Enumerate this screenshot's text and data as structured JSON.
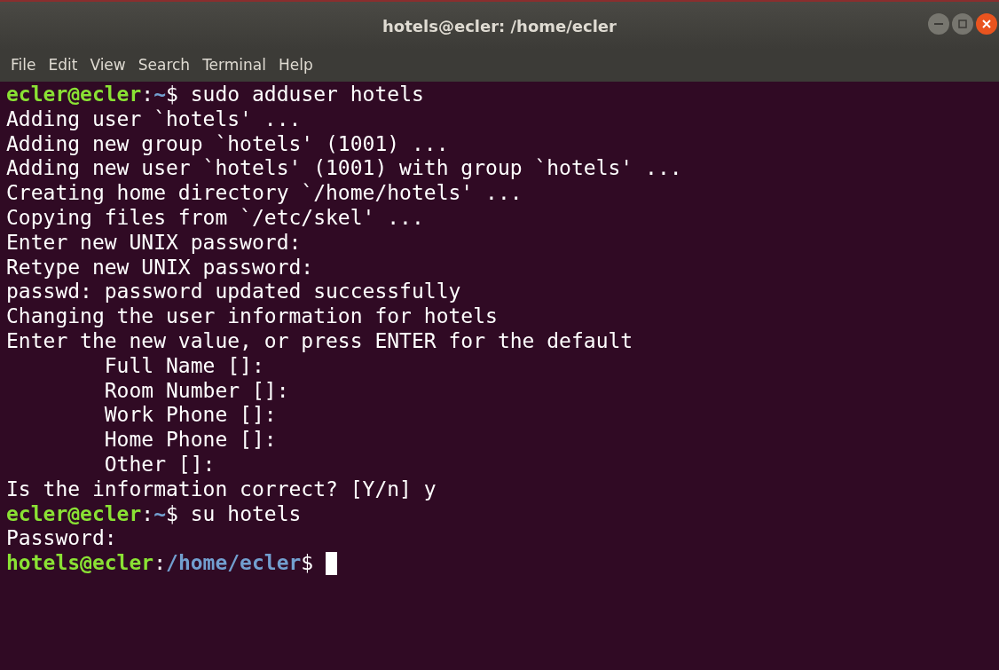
{
  "window": {
    "title": "hotels@ecler: /home/ecler"
  },
  "menu": [
    {
      "label": "File"
    },
    {
      "label": "Edit"
    },
    {
      "label": "View"
    },
    {
      "label": "Search"
    },
    {
      "label": "Terminal"
    },
    {
      "label": "Help"
    }
  ],
  "lines": [
    {
      "kind": "prompt",
      "user_host": "ecler@ecler",
      "sep": ":",
      "path": "~",
      "symbol": "$",
      "command": "sudo adduser hotels",
      "cursor": false
    },
    {
      "kind": "output",
      "text": "Adding user `hotels' ..."
    },
    {
      "kind": "output",
      "text": "Adding new group `hotels' (1001) ..."
    },
    {
      "kind": "output",
      "text": "Adding new user `hotels' (1001) with group `hotels' ..."
    },
    {
      "kind": "output",
      "text": "Creating home directory `/home/hotels' ..."
    },
    {
      "kind": "output",
      "text": "Copying files from `/etc/skel' ..."
    },
    {
      "kind": "output",
      "text": "Enter new UNIX password:"
    },
    {
      "kind": "output",
      "text": "Retype new UNIX password:"
    },
    {
      "kind": "output",
      "text": "passwd: password updated successfully"
    },
    {
      "kind": "output",
      "text": "Changing the user information for hotels"
    },
    {
      "kind": "output",
      "text": "Enter the new value, or press ENTER for the default"
    },
    {
      "kind": "output",
      "text": "        Full Name []:"
    },
    {
      "kind": "output",
      "text": "        Room Number []:"
    },
    {
      "kind": "output",
      "text": "        Work Phone []:"
    },
    {
      "kind": "output",
      "text": "        Home Phone []:"
    },
    {
      "kind": "output",
      "text": "        Other []:"
    },
    {
      "kind": "output",
      "text": "Is the information correct? [Y/n] y"
    },
    {
      "kind": "prompt",
      "user_host": "ecler@ecler",
      "sep": ":",
      "path": "~",
      "symbol": "$",
      "command": "su hotels",
      "cursor": false
    },
    {
      "kind": "output",
      "text": "Password:"
    },
    {
      "kind": "prompt",
      "user_host": "hotels@ecler",
      "sep": ":",
      "path": "/home/ecler",
      "symbol": "$",
      "cursor": true
    }
  ]
}
